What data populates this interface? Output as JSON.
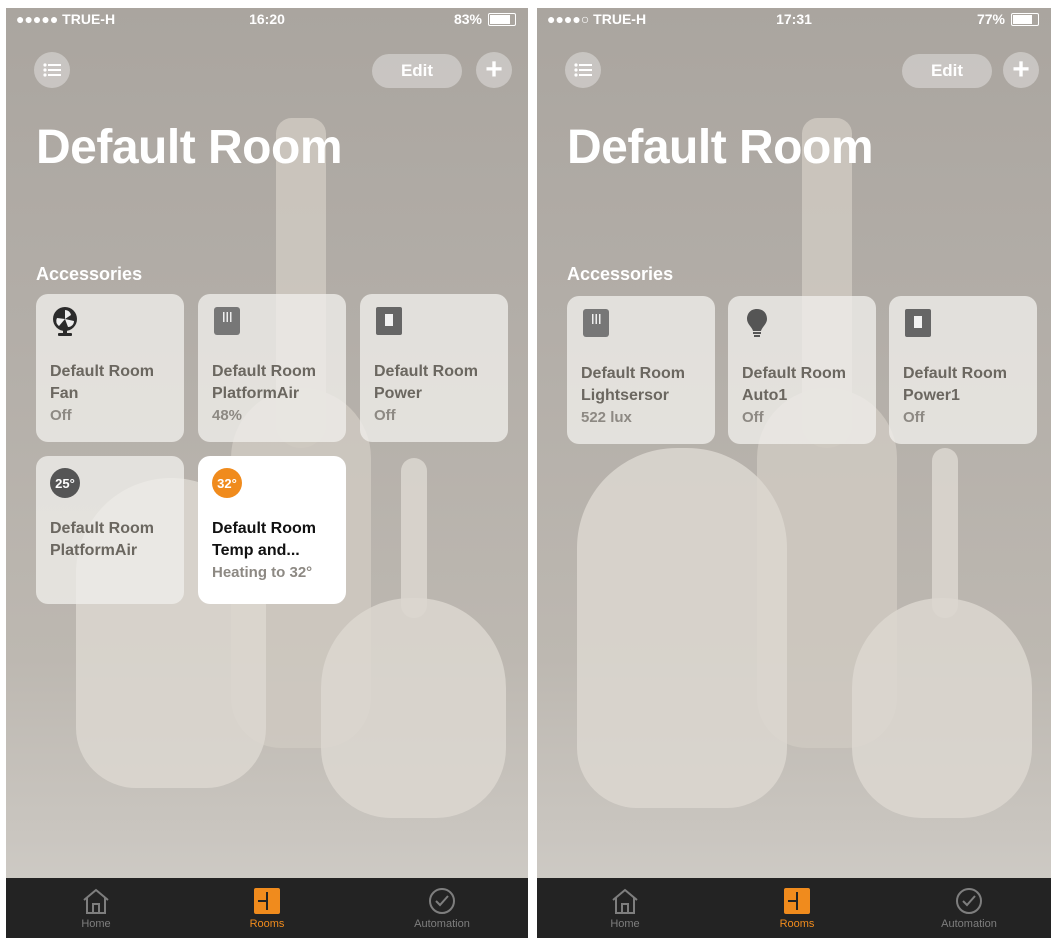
{
  "colors": {
    "accent": "#f08b1d",
    "tile_bg": "#efede9",
    "tab_bar": "#232323"
  },
  "screens": [
    {
      "status": {
        "carrier": "●●●●● TRUE-H",
        "time": "16:20",
        "battery": "83%",
        "battery_level": 0.83
      },
      "header": {
        "edit_label": "Edit",
        "add_label": "+"
      },
      "room_title": "Default Room",
      "section_title": "Accessories",
      "tiles": [
        {
          "line1": "Default Room",
          "line2": "Fan",
          "state": "Off",
          "icon": "fan-icon"
        },
        {
          "line1": "Default Room",
          "line2": "PlatformAir",
          "state": "48%",
          "icon": "platform-air-icon"
        },
        {
          "line1": "Default Room",
          "line2": "Power",
          "state": "Off",
          "icon": "power-switch-icon"
        },
        {
          "line1": "Default Room",
          "line2": "PlatformAir",
          "state": "",
          "icon": "temperature-badge-icon",
          "badge": "25°"
        },
        {
          "line1": "Default Room",
          "line2": "Temp and...",
          "state": "Heating to 32°",
          "icon": "thermostat-badge-icon",
          "badge": "32°",
          "active": true
        }
      ],
      "tabs": [
        {
          "label": "Home",
          "icon": "home-icon"
        },
        {
          "label": "Rooms",
          "icon": "rooms-icon",
          "selected": true
        },
        {
          "label": "Automation",
          "icon": "automation-clock-icon"
        }
      ]
    },
    {
      "status": {
        "carrier": "●●●●○ TRUE-H",
        "time": "17:31",
        "battery": "77%",
        "battery_level": 0.77
      },
      "header": {
        "edit_label": "Edit",
        "add_label": "+"
      },
      "room_title": "Default Room",
      "section_title": "Accessories",
      "tiles": [
        {
          "line1": "Default Room",
          "line2": "Lightsersor",
          "state": "522 lux",
          "icon": "light-sensor-icon"
        },
        {
          "line1": "Default Room",
          "line2": "Auto1",
          "state": "Off",
          "icon": "lightbulb-icon"
        },
        {
          "line1": "Default Room",
          "line2": "Power1",
          "state": "Off",
          "icon": "power-switch-icon"
        }
      ],
      "tabs": [
        {
          "label": "Home",
          "icon": "home-icon"
        },
        {
          "label": "Rooms",
          "icon": "rooms-icon",
          "selected": true
        },
        {
          "label": "Automation",
          "icon": "automation-clock-icon"
        }
      ]
    }
  ]
}
